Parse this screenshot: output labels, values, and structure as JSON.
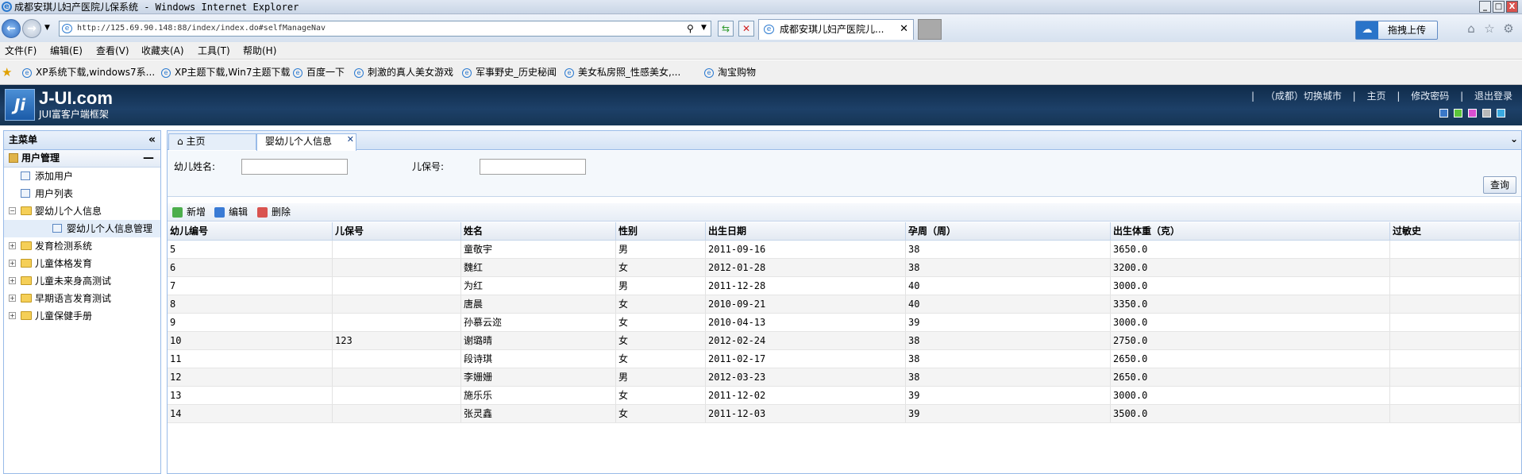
{
  "window": {
    "title": "成都安琪儿妇产医院儿保系统 - Windows Internet Explorer",
    "controls": [
      "_",
      "□",
      "X"
    ]
  },
  "browser": {
    "address": "http://125.69.90.148:88/index/index.do#selfManageNav",
    "tab_title": "成都安琪儿妇产医院儿...",
    "upload_label": "拖拽上传"
  },
  "menubar": [
    "文件(F)",
    "编辑(E)",
    "查看(V)",
    "收藏夹(A)",
    "工具(T)",
    "帮助(H)"
  ],
  "favorites": [
    "XP系统下载,windows7系...",
    "XP主题下载,Win7主题下载",
    "百度一下",
    "刺激的真人美女游戏",
    "军事野史_历史秘闻",
    "美女私房照_性感美女,...",
    "淘宝购物"
  ],
  "app": {
    "logo_text": "J-UI.com",
    "logo_sub": "JUI富客户端框架",
    "top_links": [
      "|",
      "（成都）切换城市",
      "|",
      "主页",
      "|",
      "修改密码",
      "|",
      "退出登录"
    ],
    "theme_colors": [
      "#3a78c9",
      "#5bc43a",
      "#d94fd1",
      "#b9b9b9",
      "#3aa9e0"
    ]
  },
  "sidebar": {
    "title": "主菜单",
    "section": "用户管理",
    "tree": [
      {
        "label": "添加用户",
        "level": 1,
        "kind": "doc"
      },
      {
        "label": "用户列表",
        "level": 1,
        "kind": "doc"
      },
      {
        "label": "婴幼儿个人信息",
        "level": 1,
        "kind": "folder",
        "expanded": true
      },
      {
        "label": "婴幼儿个人信息管理",
        "level": 2,
        "kind": "doc",
        "selected": true
      },
      {
        "label": "发育检测系统",
        "level": 1,
        "kind": "folder"
      },
      {
        "label": "儿童体格发育",
        "level": 1,
        "kind": "folder"
      },
      {
        "label": "儿童未来身高测试",
        "level": 1,
        "kind": "folder"
      },
      {
        "label": "早期语言发育测试",
        "level": 1,
        "kind": "folder"
      },
      {
        "label": "儿童保健手册",
        "level": 1,
        "kind": "folder"
      }
    ]
  },
  "main": {
    "tabs": [
      {
        "label": "主页",
        "active": false
      },
      {
        "label": "婴幼儿个人信息",
        "active": true
      }
    ],
    "search": {
      "name_label": "幼儿姓名:",
      "name_value": "",
      "id_label": "儿保号:",
      "id_value": "",
      "query_button": "查询"
    },
    "toolbar": {
      "add": "新增",
      "edit": "编辑",
      "delete": "删除"
    },
    "table": {
      "columns": [
        "幼儿编号",
        "儿保号",
        "姓名",
        "性别",
        "出生日期",
        "孕周（周）",
        "出生体重（克）",
        "过敏史"
      ],
      "rows": [
        [
          "5",
          "",
          "童敬宇",
          "男",
          "2011-09-16",
          "38",
          "3650.0",
          ""
        ],
        [
          "6",
          "",
          "魏红",
          "女",
          "2012-01-28",
          "38",
          "3200.0",
          ""
        ],
        [
          "7",
          "",
          "为红",
          "男",
          "2011-12-28",
          "40",
          "3000.0",
          ""
        ],
        [
          "8",
          "",
          "唐晨",
          "女",
          "2010-09-21",
          "40",
          "3350.0",
          ""
        ],
        [
          "9",
          "",
          "孙慕云迩",
          "女",
          "2010-04-13",
          "39",
          "3000.0",
          ""
        ],
        [
          "10",
          "123",
          "谢璐晴",
          "女",
          "2012-02-24",
          "38",
          "2750.0",
          ""
        ],
        [
          "11",
          "",
          "段诗琪",
          "女",
          "2011-02-17",
          "38",
          "2650.0",
          ""
        ],
        [
          "12",
          "",
          "李姗姗",
          "男",
          "2012-03-23",
          "38",
          "2650.0",
          ""
        ],
        [
          "13",
          "",
          "施乐乐",
          "女",
          "2011-12-02",
          "39",
          "3000.0",
          ""
        ],
        [
          "14",
          "",
          "张灵鑫",
          "女",
          "2011-12-03",
          "39",
          "3500.0",
          ""
        ]
      ]
    }
  }
}
